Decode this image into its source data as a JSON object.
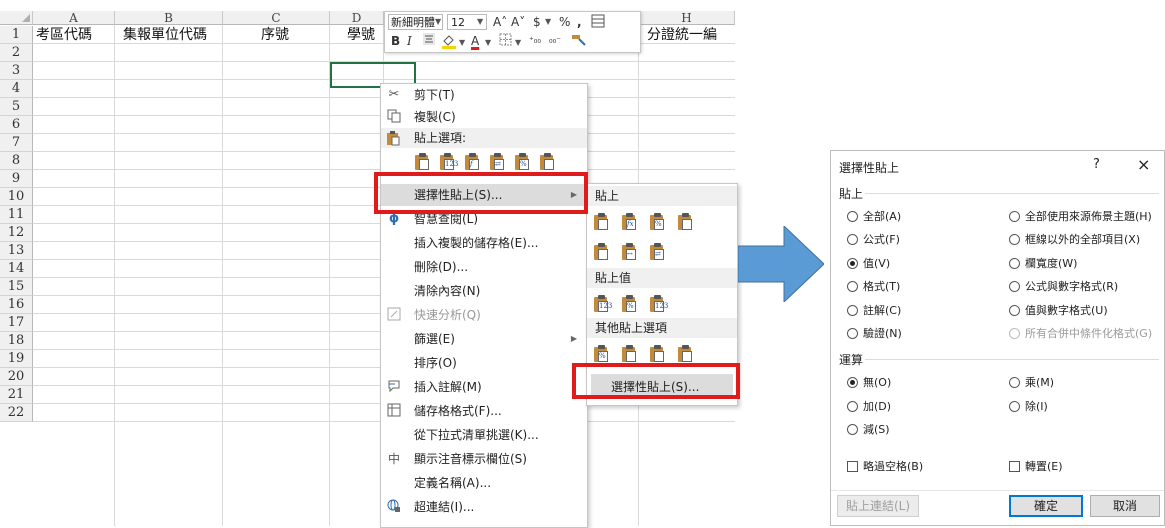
{
  "sheet": {
    "columns": [
      "A",
      "B",
      "C",
      "D",
      "H"
    ],
    "rows": [
      "1",
      "2",
      "3",
      "4",
      "5",
      "6",
      "7",
      "8",
      "9",
      "10",
      "11",
      "12",
      "13",
      "14",
      "15",
      "16",
      "17",
      "18",
      "19",
      "20",
      "21",
      "22"
    ],
    "row1": {
      "a": "考區代碼",
      "b": "集報單位代碼",
      "c": "序號",
      "d": "學號",
      "h": "分證統一編"
    }
  },
  "mini_toolbar": {
    "font": "新細明體",
    "size": "12",
    "grow_font": "A˄",
    "shrink_font": "A˅",
    "currency": "$",
    "percent": "%",
    "comma": ",",
    "bold": "B",
    "italic": "I"
  },
  "context_menu": {
    "cut": "剪下(T)",
    "copy": "複製(C)",
    "paste_options": "貼上選項:",
    "paste_special": "選擇性貼上(S)...",
    "smart_lookup": "智慧查閱(L)",
    "insert_copied": "插入複製的儲存格(E)...",
    "delete": "刪除(D)...",
    "clear": "清除內容(N)",
    "quick_analysis": "快速分析(Q)",
    "filter": "篩選(E)",
    "sort": "排序(O)",
    "insert_comment": "插入註解(M)",
    "format_cells": "儲存格格式(F)...",
    "pick_list": "從下拉式清單挑選(K)...",
    "phonetic": "顯示注音標示欄位(S)",
    "define_name": "定義名稱(A)...",
    "hyperlink": "超連結(I)..."
  },
  "submenu": {
    "paste": "貼上",
    "paste_values": "貼上值",
    "other_paste": "其他貼上選項",
    "paste_special": "選擇性貼上(S)..."
  },
  "dialog": {
    "title": "選擇性貼上",
    "help": "?",
    "close": "×",
    "paste_group": "貼上",
    "paste_options": [
      {
        "label": "全部(A)",
        "checked": false
      },
      {
        "label": "公式(F)",
        "checked": false
      },
      {
        "label": "值(V)",
        "checked": true
      },
      {
        "label": "格式(T)",
        "checked": false
      },
      {
        "label": "註解(C)",
        "checked": false
      },
      {
        "label": "驗證(N)",
        "checked": false
      },
      {
        "label": "全部使用來源佈景主題(H)",
        "checked": false
      },
      {
        "label": "框線以外的全部項目(X)",
        "checked": false
      },
      {
        "label": "欄寬度(W)",
        "checked": false
      },
      {
        "label": "公式與數字格式(R)",
        "checked": false
      },
      {
        "label": "值與數字格式(U)",
        "checked": false
      },
      {
        "label": "所有合併中條件化格式(G)",
        "checked": false
      }
    ],
    "operation_group": "運算",
    "operation_options": [
      {
        "label": "無(O)",
        "checked": true
      },
      {
        "label": "加(D)",
        "checked": false
      },
      {
        "label": "減(S)",
        "checked": false
      },
      {
        "label": "乘(M)",
        "checked": false
      },
      {
        "label": "除(I)",
        "checked": false
      }
    ],
    "skip_blanks": "略過空格(B)",
    "transpose": "轉置(E)",
    "paste_link": "貼上連結(L)",
    "ok": "確定",
    "cancel": "取消"
  },
  "colors": {
    "highlight": "#e01b1b",
    "arrow": "#5b9bd5",
    "active_cell": "#217346",
    "ok_border": "#0078d7"
  }
}
